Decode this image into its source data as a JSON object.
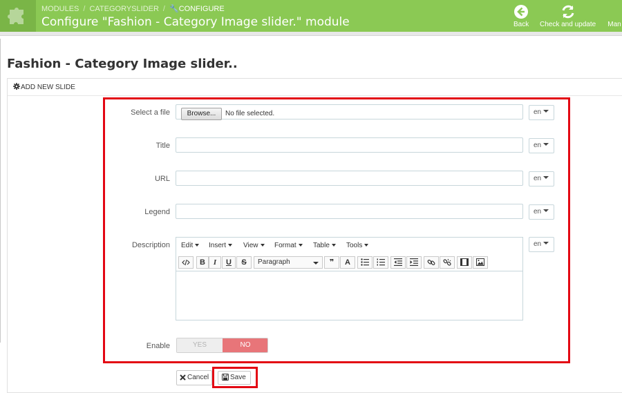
{
  "header": {
    "breadcrumb": [
      "MODULES",
      "CATEGORYSLIDER",
      "CONFIGURE"
    ],
    "title": "Configure \"Fashion - Category Image slider.\" module",
    "toolbar": [
      {
        "label": "Back",
        "icon": "arrow-left-circle-icon"
      },
      {
        "label": "Check and update",
        "icon": "refresh-icon"
      },
      {
        "label": "Man",
        "icon": "manage-icon"
      }
    ],
    "colors": {
      "bar": "#8bc954",
      "text": "#ffffff"
    }
  },
  "page": {
    "title": "Fashion - Category Image slider.."
  },
  "panel": {
    "heading": "ADD NEW SLIDE",
    "heading_icon": "gear-icon"
  },
  "form": {
    "file": {
      "label": "Select a file",
      "browse_label": "Browse...",
      "status": "No file selected.",
      "lang": "en"
    },
    "title": {
      "label": "Title",
      "value": "",
      "lang": "en"
    },
    "url": {
      "label": "URL",
      "value": "",
      "lang": "en"
    },
    "legend": {
      "label": "Legend",
      "value": "",
      "lang": "en"
    },
    "description": {
      "label": "Description",
      "lang": "en",
      "menus": [
        "Edit",
        "Insert",
        "View",
        "Format",
        "Table",
        "Tools"
      ],
      "block_format": "Paragraph",
      "toolbar_icons": [
        "source-code-icon",
        "bold-icon",
        "italic-icon",
        "underline-icon",
        "strikethrough-icon",
        "blockquote-icon",
        "text-color-icon",
        "bullet-list-icon",
        "numbered-list-icon",
        "outdent-icon",
        "indent-icon",
        "link-icon",
        "unlink-icon",
        "media-icon",
        "image-icon"
      ],
      "bold_label": "B",
      "italic_label": "I",
      "underline_label": "U",
      "strike_label": "S",
      "quote_label": "❞",
      "color_label": "A"
    },
    "enable": {
      "label": "Enable",
      "yes": "YES",
      "no": "NO",
      "value": "NO"
    }
  },
  "actions": {
    "cancel": "Cancel",
    "save": "Save"
  },
  "annotation_color": "#e30613"
}
